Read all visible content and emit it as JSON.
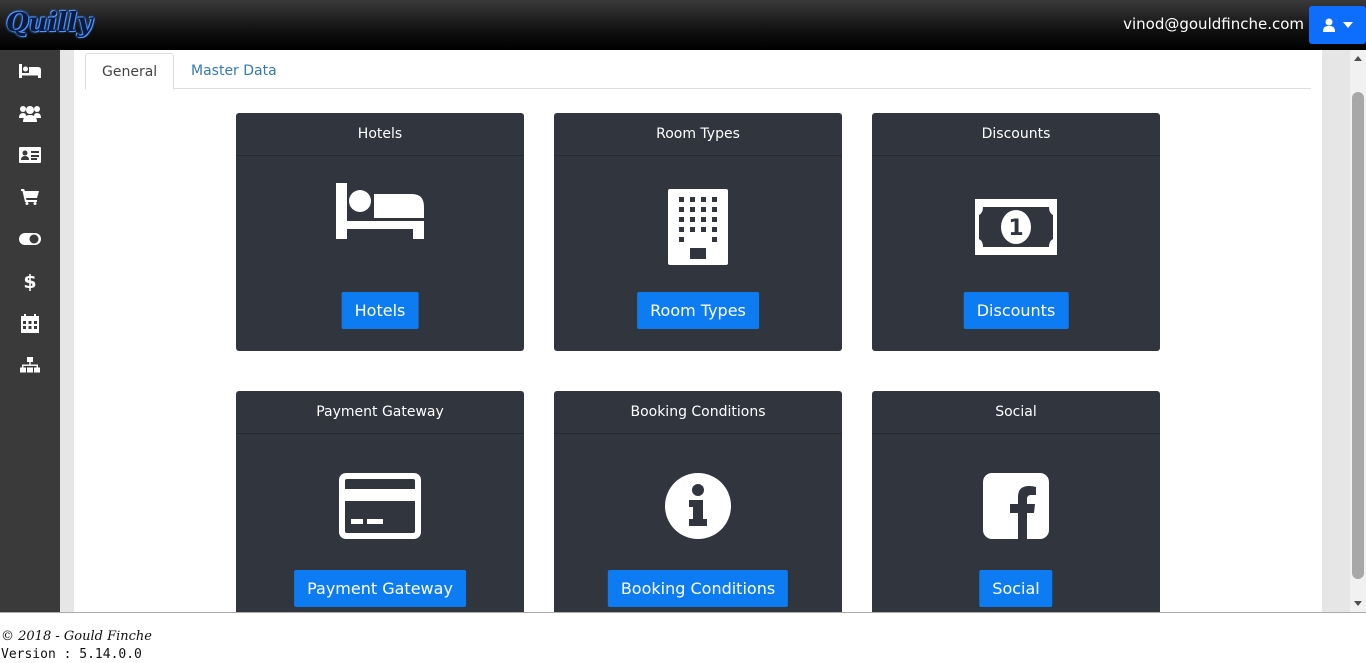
{
  "app": {
    "logo_text": "Quilly"
  },
  "header": {
    "user_email": "vinod@gouldfinche.com"
  },
  "sidebar": {
    "items": [
      {
        "icon": "bed-icon"
      },
      {
        "icon": "users-icon"
      },
      {
        "icon": "id-card-icon"
      },
      {
        "icon": "cart-icon"
      },
      {
        "icon": "toggle-icon"
      },
      {
        "icon": "dollar-icon"
      },
      {
        "icon": "calendar-icon"
      },
      {
        "icon": "sitemap-icon"
      }
    ]
  },
  "tabs": [
    {
      "label": "General",
      "active": true
    },
    {
      "label": "Master Data",
      "active": false
    }
  ],
  "cards": [
    {
      "title": "Hotels",
      "button": "Hotels",
      "icon": "bed-icon"
    },
    {
      "title": "Room Types",
      "button": "Room Types",
      "icon": "building-icon"
    },
    {
      "title": "Discounts",
      "button": "Discounts",
      "icon": "money-bill-icon"
    },
    {
      "title": "Payment Gateway",
      "button": "Payment Gateway",
      "icon": "credit-card-icon"
    },
    {
      "title": "Booking Conditions",
      "button": "Booking Conditions",
      "icon": "info-circle-icon"
    },
    {
      "title": "Social",
      "button": "Social",
      "icon": "facebook-icon"
    }
  ],
  "footer": {
    "copyright": "© 2018 - Gould Finche",
    "version": "Version : 5.14.0.0"
  },
  "colors": {
    "accent": "#0d7cf2",
    "card_bg": "#30353e",
    "sidebar_bg": "#3a3a3a"
  }
}
